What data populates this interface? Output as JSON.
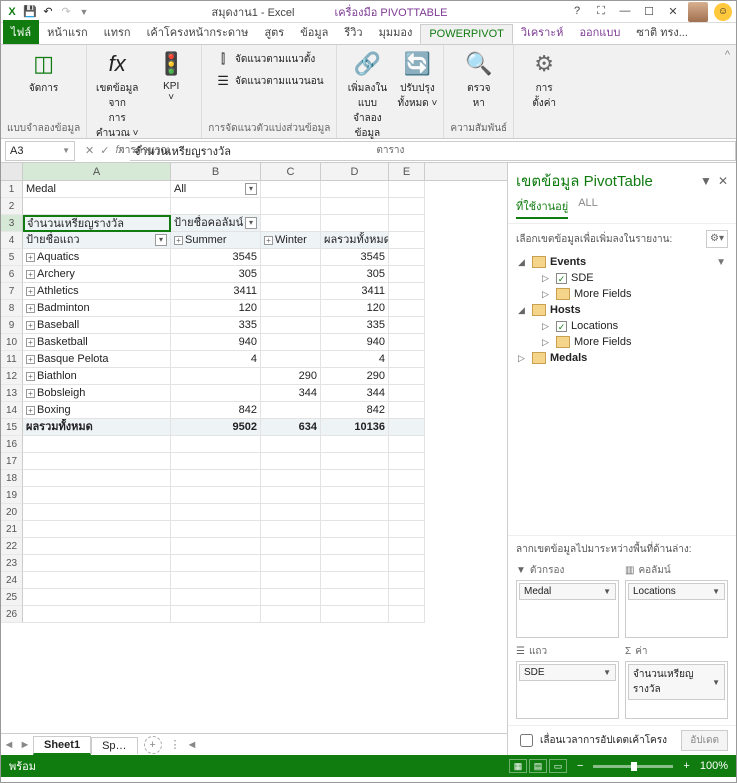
{
  "title": {
    "excel_icon": "X",
    "doc": "สมุดงาน1 - Excel",
    "tools": "เครื่องมือ PIVOTTABLE"
  },
  "winControls": {
    "help": "?",
    "full": "⛶",
    "min": "—",
    "max": "☐",
    "close": "✕"
  },
  "tabs": [
    "ไฟล์",
    "หน้าแรก",
    "แทรก",
    "เค้าโครงหน้ากระดาษ",
    "สูตร",
    "ข้อมูล",
    "รีวิว",
    "มุมมอง",
    "POWERPIVOT",
    "วิเคราะห์",
    "ออกแบบ",
    "ซาติ ทรง..."
  ],
  "activeTab": 8,
  "ribbon": {
    "g1": {
      "label": "แบบจำลองข้อมูล",
      "btn": "จัดการ"
    },
    "g2": {
      "label": "การคำนวณ",
      "b1": "เขตข้อมูลจาก\nการคำนวณ ˅",
      "b2": "KPI\n˅"
    },
    "g3": {
      "label": "การจัดแนวตัวแบ่งส่วนข้อมูล",
      "b1": "จัดแนวตามแนวตั้ง",
      "b2": "จัดแนวตามแนวนอน"
    },
    "g4": {
      "label": "ตาราง",
      "b1": "เพิ่มลงในแบบ\nจำลองข้อมูล",
      "b2": "ปรับปรุง\nทั้งหมด ˅"
    },
    "g5": {
      "label": "ความสัมพันธ์",
      "b1": "ตรวจ\nหา"
    },
    "g6": {
      "label": "",
      "b1": "การ\nตั้งค่า"
    }
  },
  "nameBox": "A3",
  "formula": "จำนวนเหรียญรางวัล",
  "colHeaders": [
    "A",
    "B",
    "C",
    "D",
    "E"
  ],
  "pivot": {
    "filterLabel": "Medal",
    "filterValue": "All",
    "valueLabel": "จำนวนเหรียญรางวัล",
    "colLabel": "ป้ายชื่อคอลัมน์",
    "rowLabel": "ป้ายชื่อแถว",
    "sumCol": "ผลรวมทั้งหมด",
    "col1": "Summer",
    "col2": "Winter",
    "rows": [
      {
        "n": "Aquatics",
        "s": "3545",
        "w": "",
        "t": "3545"
      },
      {
        "n": "Archery",
        "s": "305",
        "w": "",
        "t": "305"
      },
      {
        "n": "Athletics",
        "s": "3411",
        "w": "",
        "t": "3411"
      },
      {
        "n": "Badminton",
        "s": "120",
        "w": "",
        "t": "120"
      },
      {
        "n": "Baseball",
        "s": "335",
        "w": "",
        "t": "335"
      },
      {
        "n": "Basketball",
        "s": "940",
        "w": "",
        "t": "940"
      },
      {
        "n": "Basque Pelota",
        "s": "4",
        "w": "",
        "t": "4"
      },
      {
        "n": "Biathlon",
        "s": "",
        "w": "290",
        "t": "290"
      },
      {
        "n": "Bobsleigh",
        "s": "",
        "w": "344",
        "t": "344"
      },
      {
        "n": "Boxing",
        "s": "842",
        "w": "",
        "t": "842"
      }
    ],
    "totRow": {
      "label": "ผลรวมทั้งหมด",
      "s": "9502",
      "w": "634",
      "t": "10136"
    }
  },
  "sheets": [
    "Sheet1",
    "Sp…"
  ],
  "pane": {
    "title": "เขตข้อมูล PivotTable",
    "tab1": "ที่ใช้งานอยู่",
    "tab2": "ALL",
    "instr": "เลือกเขตข้อมูลเพื่อเพิ่มลงในรายงาน:",
    "fields": {
      "events": "Events",
      "sde": "SDE",
      "more": "More Fields",
      "hosts": "Hosts",
      "locations": "Locations",
      "medals": "Medals"
    },
    "drag": "ลากเขตข้อมูลไปมาระหว่างพื้นที่ด้านล่าง:",
    "zones": {
      "filters": "ตัวกรอง",
      "columns": "คอลัมน์",
      "rows": "แถว",
      "values": "ค่า",
      "f": "Medal",
      "c": "Locations",
      "r": "SDE",
      "v": "จำนวนเหรียญรางวัล"
    },
    "defer": "เลื่อนเวลาการอัปเดตเค้าโครง",
    "update": "อัปเดต"
  },
  "status": {
    "ready": "พร้อม",
    "zoom": "100%"
  }
}
